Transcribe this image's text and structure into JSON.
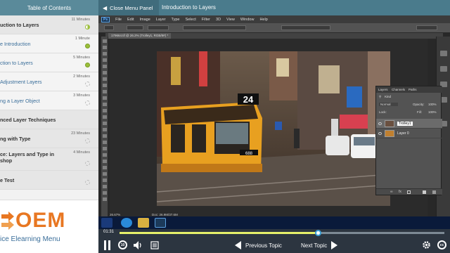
{
  "toc": {
    "header": "Table of Contents",
    "items": [
      {
        "label": "uction to Layers",
        "duration": "11 Minutes",
        "status": "half",
        "type": "section"
      },
      {
        "label": "e Introduction",
        "duration": "1 Minute",
        "status": "done",
        "type": "topic"
      },
      {
        "label": "ction to Layers",
        "duration": "5 Minutes",
        "status": "done",
        "type": "topic"
      },
      {
        "label": "Adjustment Layers",
        "duration": "2 Minutes",
        "status": "none",
        "type": "topic"
      },
      {
        "label": "ng a Layer Object",
        "duration": "3 Minutes",
        "status": "none",
        "type": "topic"
      },
      {
        "label": "nced Layer Techniques",
        "duration": "",
        "status": "",
        "type": "section"
      },
      {
        "label": "ng with Type",
        "duration": "23 Minutes",
        "status": "none",
        "type": "section"
      },
      {
        "label": "ce: Layers and Type in shop",
        "duration": "4 Minutes",
        "status": "none",
        "type": "section"
      },
      {
        "label": "e Test",
        "duration": "",
        "status": "none",
        "type": "section"
      }
    ],
    "logo_text": "OEM",
    "logo_sub": "ice Elearning Menu"
  },
  "player_top": {
    "close_label": "Close Menu Panel",
    "topic_title": "Introduction to Layers"
  },
  "photoshop": {
    "logo": "Ps",
    "menu": [
      "File",
      "Edit",
      "Image",
      "Layer",
      "Type",
      "Select",
      "Filter",
      "3D",
      "View",
      "Window",
      "Help"
    ],
    "doc_tab": "179664.tif @ 26.2% (Trolley1, RGB/8#) *",
    "zoom": "26.67%",
    "doc_size": "Doc: 26.9M/37.6M",
    "layers_panel": {
      "tabs": [
        "Layers",
        "Channels",
        "Paths"
      ],
      "kind": "Kind",
      "blend": "Normal",
      "opacity_label": "Opacity:",
      "opacity": "100%",
      "lock_label": "Lock:",
      "fill_label": "Fill:",
      "fill": "100%",
      "layers": [
        {
          "name": "Trolley1",
          "selected": true
        },
        {
          "name": "Layer 0",
          "selected": false
        }
      ]
    }
  },
  "player_bottom": {
    "time": "01:31",
    "progress": 0.61,
    "prev_label": "Previous Topic",
    "next_label": "Next Topic",
    "replay_label": "10",
    "cc_label": "cc"
  },
  "colors": {
    "accent_green": "#9bbf3a",
    "player_teal": "#4a7b8c",
    "logo_orange": "#e87722",
    "progress_fill": "#e6f06a"
  }
}
